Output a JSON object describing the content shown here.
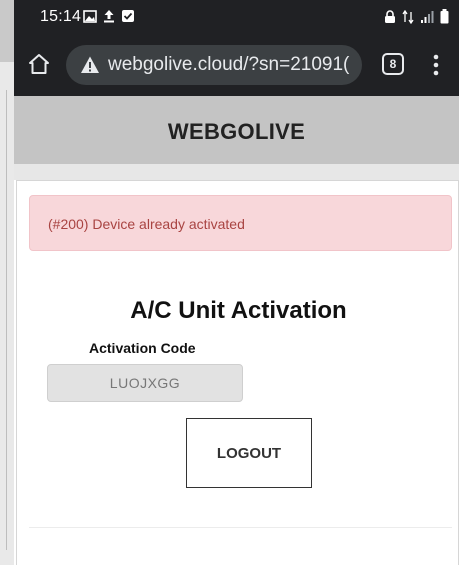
{
  "status_bar": {
    "time": "15:14",
    "left_icons": [
      "image-icon",
      "upload-icon",
      "check-box-icon"
    ],
    "right_icons": [
      "lock-icon",
      "network-arrows-icon",
      "signal-icon",
      "battery-icon"
    ]
  },
  "browser": {
    "url": "webgolive.cloud/?sn=21091(",
    "tab_count": "8",
    "icons": [
      "home-icon",
      "warning-icon",
      "tabs-icon",
      "more-vert-icon"
    ]
  },
  "site": {
    "title": "WEBGOLIVE"
  },
  "alert": {
    "text": "(#200) Device already activated",
    "background": "#f8d7da",
    "color": "#a94442"
  },
  "activation": {
    "title": "A/C Unit Activation",
    "code_label": "Activation Code",
    "code_value": "LUOJXGG",
    "logout_label": "LOGOUT"
  }
}
